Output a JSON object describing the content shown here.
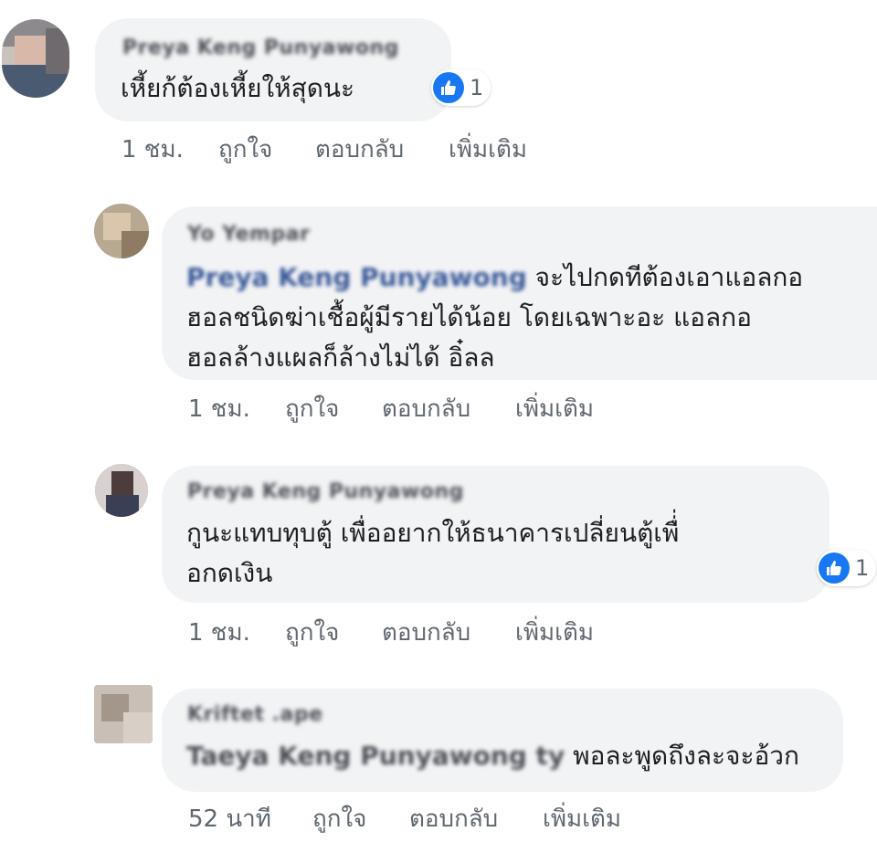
{
  "comments": [
    {
      "author": "Preya Keng Punyawong",
      "text_lines": [
        "เหี้ยก้ต้องเหี้ยให้สุดนะ"
      ],
      "reactions": {
        "count": "1"
      },
      "time": "1 ชม.",
      "actions": {
        "like": "ถูกใจ",
        "reply": "ตอบกลับ",
        "more": "เพิ่มเติม"
      }
    },
    {
      "author": "Yo Yempar",
      "mention": "Preya Keng Punyawong",
      "text_lines": [
        "จะไปกดทีต้องเอาแอลกอ",
        "ฮอลชนิดฆ่าเชื้อผู้มีรายได้น้อย โดยเฉพาะอะ แอลกอ",
        "ฮอลล้างแผลก็ล้างไม่ได้ อิ๋ลล"
      ],
      "time": "1 ชม.",
      "actions": {
        "like": "ถูกใจ",
        "reply": "ตอบกลับ",
        "more": "เพิ่มเติม"
      }
    },
    {
      "author": "Preya Keng Punyawong",
      "text_lines": [
        "กูนะแทบทุบตู้ เพื่ออยากให้ธนาคารเปลี่ยนตู้เพื่่",
        "อกดเงิน"
      ],
      "reactions": {
        "count": "1"
      },
      "time": "1 ชม.",
      "actions": {
        "like": "ถูกใจ",
        "reply": "ตอบกลับ",
        "more": "เพิ่มเติม"
      }
    },
    {
      "author": "Kriftet .ape",
      "mention": "Taeya Keng Punyawong ty",
      "text_lines": [
        "พอละพูดถึงละจะอ้วก"
      ],
      "time": "52 นาที",
      "actions": {
        "like": "ถูกใจ",
        "reply": "ตอบกลับ",
        "more": "เพิ่มเติม"
      }
    }
  ],
  "icons": {
    "reaction": "like-thumb-icon"
  },
  "colors": {
    "bubble": "#f2f3f5",
    "like_blue": "#1877f2",
    "meta_gray": "#606770"
  }
}
